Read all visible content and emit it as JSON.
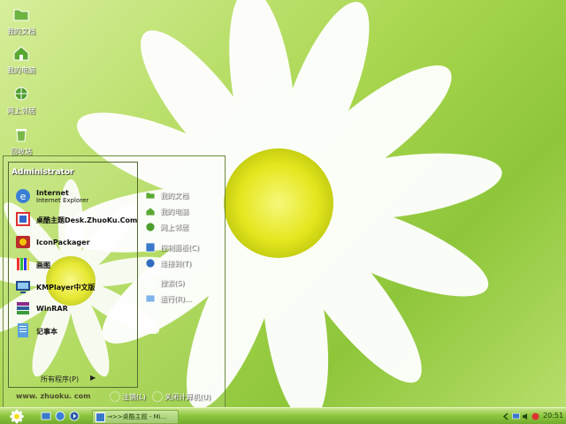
{
  "desktop_icons": [
    {
      "label": "我的文档",
      "icon": "folder-icon"
    },
    {
      "label": "我的电脑",
      "icon": "house-icon"
    },
    {
      "label": "网上邻居",
      "icon": "globe-icon"
    },
    {
      "label": "回收站",
      "icon": "recycle-bin-icon"
    }
  ],
  "start_menu": {
    "user": "Administrator",
    "programs": [
      {
        "title": "Internet",
        "subtitle": "Internet Explorer",
        "icon": "internet-explorer-icon"
      },
      {
        "title": "桌酷主题Desk.ZhuoKu.Com",
        "icon": "theme-icon"
      },
      {
        "title": "IconPackager",
        "icon": "iconpackager-icon"
      },
      {
        "title": "画图",
        "icon": "paint-icon"
      },
      {
        "title": "KMPlayer中文版",
        "icon": "kmplayer-icon"
      },
      {
        "title": "WinRAR",
        "icon": "winrar-icon"
      },
      {
        "title": "记事本",
        "icon": "notepad-icon"
      }
    ],
    "all_programs": "所有程序(P)",
    "site": "www. zhuoku. com",
    "right_items": [
      {
        "label": "我的文档",
        "icon": "documents-icon"
      },
      {
        "label": "我的电脑",
        "icon": "computer-icon"
      },
      {
        "label": "网上邻居",
        "icon": "network-icon"
      },
      {
        "label": "控制面板(C)",
        "icon": "control-panel-icon"
      },
      {
        "label": "连接到(T)",
        "icon": "connect-icon"
      },
      {
        "label": "搜索(S)",
        "icon": "search-icon"
      },
      {
        "label": "运行(R)...",
        "icon": "run-icon"
      }
    ],
    "logoff": "注销(L)",
    "shutdown": "关闭计算机(U)"
  },
  "taskbar": {
    "task_label": "→>>桌酷主题 - Mi...",
    "clock": "20:51"
  },
  "colors": {
    "taskbar": "#8cc63f",
    "accent": "#a8d64e"
  }
}
